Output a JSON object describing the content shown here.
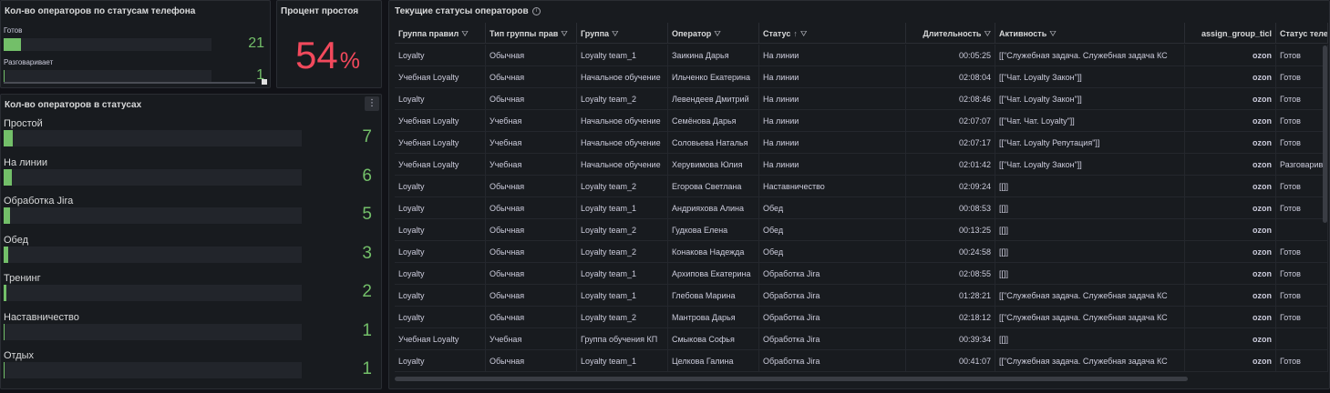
{
  "panel_phone": {
    "title": "Кол-во операторов по статусам телефона",
    "rows": [
      {
        "label": "Готов",
        "value": "21",
        "fraction": 0.085
      },
      {
        "label": "Разговаривает",
        "value": "1",
        "fraction": 0.004
      }
    ]
  },
  "panel_idle": {
    "title": "Процент простоя",
    "value": "54",
    "unit": "%"
  },
  "panel_statuses": {
    "title": "Кол-во операторов в статусах",
    "menu_icon": "⋮",
    "rows": [
      {
        "label": "Простой",
        "value": "7",
        "fraction": 0.03
      },
      {
        "label": "На линии",
        "value": "6",
        "fraction": 0.026
      },
      {
        "label": "Обработка Jira",
        "value": "5",
        "fraction": 0.022
      },
      {
        "label": "Обед",
        "value": "3",
        "fraction": 0.015
      },
      {
        "label": "Тренинг",
        "value": "2",
        "fraction": 0.009
      },
      {
        "label": "Наставничество",
        "value": "1",
        "fraction": 0.004
      },
      {
        "label": "Отдых",
        "value": "1",
        "fraction": 0.004
      }
    ]
  },
  "panel_table": {
    "title": "Текущие статусы операторов",
    "info_icon": "i",
    "filter_icon": "⛛",
    "sort_icon": "↑",
    "columns": [
      "Группа правил",
      "Тип группы прав",
      "Группа",
      "Оператор",
      "Статус",
      "Длительность",
      "Активность",
      "assign_group_ticl",
      "Статус теле"
    ],
    "rows": [
      [
        "Loyalty",
        "Обычная",
        "Loyalty team_1",
        "Заикина Дарья",
        "На линии",
        "00:05:25",
        "[[\"Служебная задача. Служебная задача КС",
        "ozon",
        "Готов"
      ],
      [
        "Учебная Loyalty",
        "Обычная",
        "Начальное обучение",
        "Ильченко Екатерина",
        "На линии",
        "02:08:04",
        "[[\"Чат. Loyalty Закон\"]]",
        "ozon",
        "Готов"
      ],
      [
        "Loyalty",
        "Обычная",
        "Loyalty team_2",
        "Левендеев Дмитрий",
        "На линии",
        "02:08:46",
        "[[\"Чат. Loyalty Закон\"]]",
        "ozon",
        "Готов"
      ],
      [
        "Учебная Loyalty",
        "Учебная",
        "Начальное обучение",
        "Семёнова Дарья",
        "На линии",
        "02:07:07",
        "[[\"Чат. Чат. Loyalty\"]]",
        "ozon",
        "Готов"
      ],
      [
        "Учебная Loyalty",
        "Учебная",
        "Начальное обучение",
        "Соловьева Наталья",
        "На линии",
        "02:07:17",
        "[[\"Чат. Loyalty Репутация\"]]",
        "ozon",
        "Готов"
      ],
      [
        "Учебная Loyalty",
        "Учебная",
        "Начальное обучение",
        "Херувимова Юлия",
        "На линии",
        "02:01:42",
        "[[\"Чат. Loyalty Закон\"]]",
        "ozon",
        "Разговаривает"
      ],
      [
        "Loyalty",
        "Обычная",
        "Loyalty team_2",
        "Егорова Светлана",
        "Наставничество",
        "02:09:24",
        "[[]]",
        "ozon",
        "Готов"
      ],
      [
        "Loyalty",
        "Обычная",
        "Loyalty team_1",
        "Андрияхова Алина",
        "Обед",
        "00:08:53",
        "[[]]",
        "ozon",
        "Готов"
      ],
      [
        "Loyalty",
        "Обычная",
        "Loyalty team_2",
        "Гудкова Елена",
        "Обед",
        "00:13:25",
        "[[]]",
        "ozon",
        ""
      ],
      [
        "Loyalty",
        "Обычная",
        "Loyalty team_2",
        "Конакова Надежда",
        "Обед",
        "00:24:58",
        "[[]]",
        "ozon",
        "Готов"
      ],
      [
        "Loyalty",
        "Обычная",
        "Loyalty team_1",
        "Архипова Екатерина",
        "Обработка Jira",
        "02:08:55",
        "[[]]",
        "ozon",
        "Готов"
      ],
      [
        "Loyalty",
        "Обычная",
        "Loyalty team_1",
        "Глебова Марина",
        "Обработка Jira",
        "01:28:21",
        "[[\"Служебная задача. Служебная задача КС",
        "ozon",
        "Готов"
      ],
      [
        "Loyalty",
        "Обычная",
        "Loyalty team_2",
        "Мантрова Дарья",
        "Обработка Jira",
        "02:18:12",
        "[[\"Служебная задача. Служебная задача КС",
        "ozon",
        "Готов"
      ],
      [
        "Учебная Loyalty",
        "Учебная",
        "Группа обучения КП",
        "Смыкова Софья",
        "Обработка Jira",
        "00:39:34",
        "[[]]",
        "ozon",
        ""
      ],
      [
        "Loyalty",
        "Обычная",
        "Loyalty team_1",
        "Целкова Галина",
        "Обработка Jira",
        "00:41:07",
        "[[\"Служебная задача. Служебная задача КС",
        "ozon",
        "Готов"
      ]
    ]
  }
}
